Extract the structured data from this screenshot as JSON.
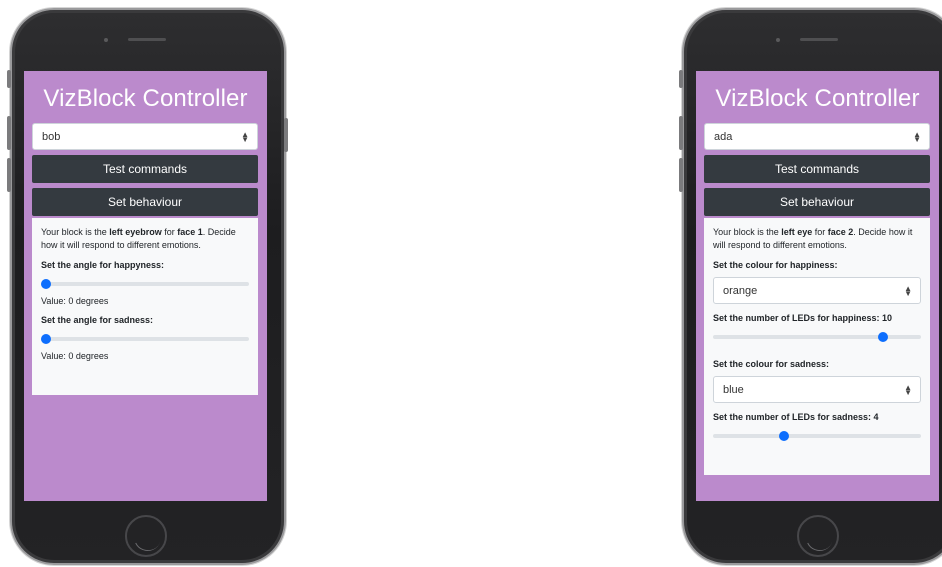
{
  "left_phone": {
    "title": "VizBlock Controller",
    "block_select": {
      "value": "bob"
    },
    "test_button": "Test commands",
    "behaviour_button": "Set behaviour",
    "intro": {
      "prefix": "Your block is the ",
      "part": "left eyebrow",
      "middle": " for ",
      "face": "face 1",
      "suffix": ". Decide how it will respond to different emotions."
    },
    "happiness": {
      "label": "Set the angle for happyness:",
      "value": 0,
      "min": 0,
      "max": 180,
      "value_text": "Value: 0 degrees"
    },
    "sadness": {
      "label": "Set the angle for sadness:",
      "value": 0,
      "min": 0,
      "max": 180,
      "value_text": "Value: 0 degrees"
    }
  },
  "right_phone": {
    "title": "VizBlock Controller",
    "block_select": {
      "value": "ada"
    },
    "test_button": "Test commands",
    "behaviour_button": "Set behaviour",
    "intro": {
      "prefix": "Your block is the ",
      "part": "left eye",
      "middle": " for ",
      "face": "face 2",
      "suffix": ". Decide how it will respond to different emotions."
    },
    "happiness_colour": {
      "label": "Set the colour for happiness:",
      "value": "orange"
    },
    "happiness_leds": {
      "label": "Set the number of LEDs for happiness: 10",
      "value": 10,
      "min": 0,
      "max": 12
    },
    "sadness_colour": {
      "label": "Set the colour for sadness:",
      "value": "blue"
    },
    "sadness_leds": {
      "label": "Set the number of LEDs for sadness: 4",
      "value": 4,
      "min": 0,
      "max": 12
    }
  },
  "colors": {
    "screen_bg": "#bb8acc",
    "button_bg": "#343a40",
    "panel_bg": "#f8f9fa",
    "slider_thumb": "#0d6efd"
  },
  "icons": [
    "select-caret-icon",
    "camera-icon",
    "speaker-icon",
    "home-button-icon"
  ]
}
